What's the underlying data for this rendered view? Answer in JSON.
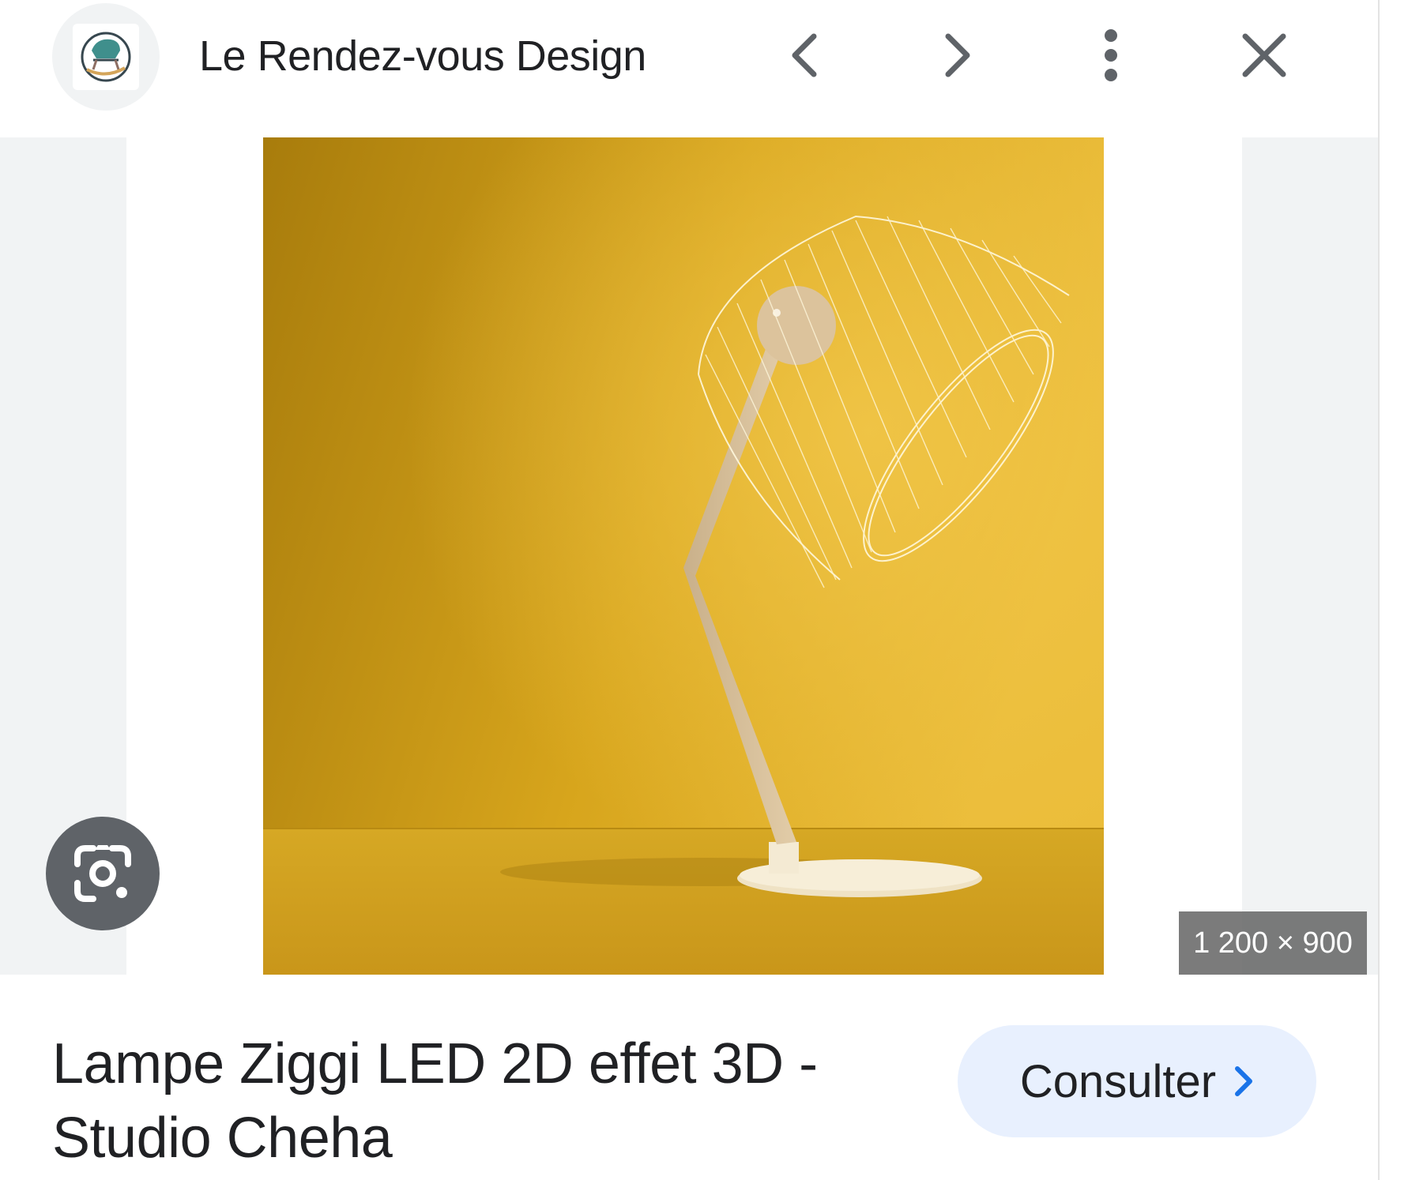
{
  "header": {
    "site_name": "Le Rendez-vous Design",
    "logo_icon": "rocking-chair-logo",
    "back_icon": "chevron-left-icon",
    "forward_icon": "chevron-right-icon",
    "menu_icon": "more-vert-icon",
    "close_icon": "close-icon"
  },
  "image": {
    "dimensions": "1 200 × 900",
    "lens_icon": "google-lens-icon"
  },
  "result": {
    "title": "Lampe Ziggi LED 2D effet 3D - Studio Cheha",
    "action_label": "Consulter",
    "action_icon": "chevron-right-icon",
    "accent_color": "#1a73e8"
  }
}
